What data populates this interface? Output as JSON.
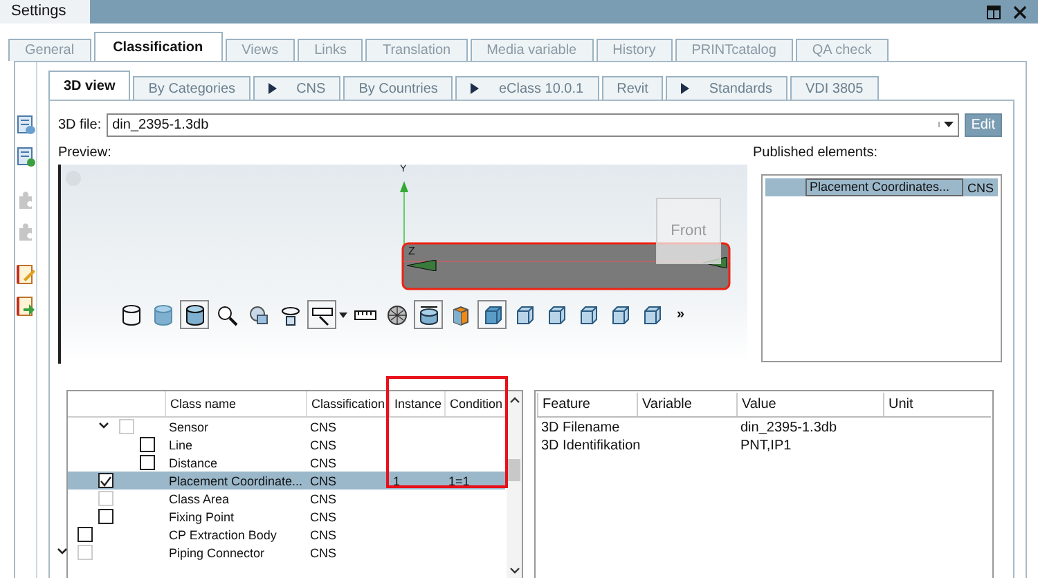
{
  "window": {
    "title": "Settings"
  },
  "tabs": [
    {
      "label": "General",
      "selected": false
    },
    {
      "label": "Classification",
      "selected": true
    },
    {
      "label": "Views",
      "selected": false
    },
    {
      "label": "Links",
      "selected": false
    },
    {
      "label": "Translation",
      "selected": false
    },
    {
      "label": "Media variable",
      "selected": false
    },
    {
      "label": "History",
      "selected": false
    },
    {
      "label": "PRINTcatalog",
      "selected": false
    },
    {
      "label": "QA check",
      "selected": false
    }
  ],
  "sidebar_tools": [
    {
      "kind": "list_db",
      "disabled": false
    },
    {
      "kind": "list_add",
      "disabled": false
    },
    {
      "kind": "puzzle",
      "disabled": true
    },
    {
      "kind": "puzzle_gear",
      "disabled": true
    },
    {
      "kind": "edit_doc",
      "disabled": false
    },
    {
      "kind": "export_doc",
      "disabled": false
    }
  ],
  "subtabs": [
    {
      "label": "3D view",
      "selected": true,
      "arrow": false
    },
    {
      "label": "By Categories",
      "selected": false,
      "arrow": false
    },
    {
      "label": "CNS",
      "selected": false,
      "arrow": true
    },
    {
      "label": "By Countries",
      "selected": false,
      "arrow": false
    },
    {
      "label": "eClass 10.0.1",
      "selected": false,
      "arrow": true
    },
    {
      "label": "Revit",
      "selected": false,
      "arrow": false
    },
    {
      "label": "Standards",
      "selected": false,
      "arrow": true
    },
    {
      "label": "VDI 3805",
      "selected": false,
      "arrow": false
    }
  ],
  "file": {
    "label": "3D file:",
    "value": "din_2395-1.3db",
    "button": "Edit"
  },
  "preview": {
    "label": "Preview:",
    "axis_y": "Y",
    "axis_z": "Z",
    "view_cube": "Front",
    "more": "»",
    "tools": [
      {
        "kind": "cylinder_wire",
        "selected": false
      },
      {
        "kind": "cylinder_shaded",
        "selected": false
      },
      {
        "kind": "cylinder_solid",
        "selected": true
      },
      {
        "kind": "zoom",
        "selected": false
      },
      {
        "kind": "zoom_sphere",
        "selected": false
      },
      {
        "kind": "rotate",
        "selected": false
      },
      {
        "kind": "measure",
        "selected": true
      },
      {
        "kind": "ruler",
        "selected": false
      },
      {
        "kind": "mesh",
        "selected": false
      },
      {
        "kind": "cylinder_dim",
        "selected": true
      },
      {
        "kind": "cube_orange",
        "selected": false
      },
      {
        "kind": "cube",
        "selected": true
      },
      {
        "kind": "cube_front",
        "selected": false
      },
      {
        "kind": "cube_side",
        "selected": false
      },
      {
        "kind": "cube_top",
        "selected": false
      },
      {
        "kind": "cube_back",
        "selected": false
      },
      {
        "kind": "cube_iso",
        "selected": false
      }
    ]
  },
  "published": {
    "label": "Published elements:",
    "rows": [
      {
        "name": "Placement Coordinates...",
        "classification": "CNS",
        "selected": true
      }
    ]
  },
  "tree": {
    "columns": [
      "Class name",
      "Classification",
      "Instance",
      "Condition"
    ],
    "rows": [
      {
        "children": [
          {
            "children": [
              {
                "name": "Sensor",
                "classification": "CNS",
                "checked": false,
                "disabled": true,
                "expanded": true,
                "selected": false,
                "children": [
                  {
                    "name": "Line",
                    "classification": "CNS",
                    "checked": false,
                    "disabled": false,
                    "selected": false
                  },
                  {
                    "name": "Distance",
                    "classification": "CNS",
                    "checked": false,
                    "disabled": false,
                    "selected": false
                  }
                ]
              }
            ]
          },
          {
            "name": "Placement Coordinate...",
            "classification": "CNS",
            "instance": "1",
            "condition": "1=1",
            "checked": true,
            "disabled": false,
            "selected": true
          },
          {
            "name": "Class Area",
            "classification": "CNS",
            "checked": false,
            "disabled": true,
            "selected": false
          },
          {
            "name": "Fixing Point",
            "classification": "CNS",
            "checked": false,
            "disabled": false,
            "selected": false
          }
        ]
      },
      {
        "name": "CP Extraction Body",
        "classification": "CNS",
        "checked": false,
        "disabled": false,
        "selected": false
      },
      {
        "name": "Piping Connector",
        "classification": "CNS",
        "checked": false,
        "disabled": true,
        "expanded": true,
        "selected": false
      }
    ]
  },
  "features": {
    "columns": [
      "Feature",
      "Variable",
      "Value",
      "Unit"
    ],
    "rows": [
      {
        "feature": "3D Filename",
        "value": "din_2395-1.3db"
      },
      {
        "feature": "3D Identifikation",
        "value": "PNT,IP1"
      }
    ]
  }
}
